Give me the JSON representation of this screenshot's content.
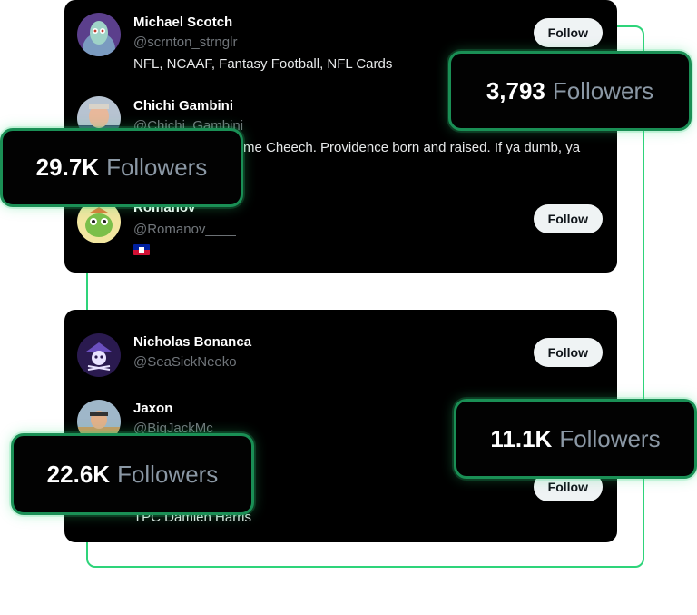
{
  "top_list": [
    {
      "name": "Michael Scotch",
      "handle": "@scrnton_strnglr",
      "bio": "NFL, NCAAF, Fantasy Football, NFL Cards",
      "follow_label": "Follow"
    },
    {
      "name": "Chichi Gambini",
      "handle": "@Chichi_Gambini",
      "bio": "me Cheech. Providence born and raised. If ya dumb, ya"
    },
    {
      "name": "Romanov",
      "handle": "@Romanov____",
      "follow_label": "Follow",
      "flag": "haiti-flag"
    }
  ],
  "bottom_list": [
    {
      "name": "Nicholas Bonanca",
      "handle": "@SeaSickNeeko",
      "follow_label": "Follow"
    },
    {
      "name": "Jaxon",
      "handle": "@BigJackMc"
    },
    {
      "follow_label": "Follow",
      "bio": "TPC Damien Harris"
    }
  ],
  "badges": [
    {
      "number": "3,793",
      "label": "Followers"
    },
    {
      "number": "29.7K",
      "label": "Followers"
    },
    {
      "number": "11.1K",
      "label": "Followers"
    },
    {
      "number": "22.6K",
      "label": "Followers"
    }
  ],
  "colors": {
    "accent": "#2ed47a",
    "card_bg": "#000000",
    "button_bg": "#eff3f4"
  }
}
